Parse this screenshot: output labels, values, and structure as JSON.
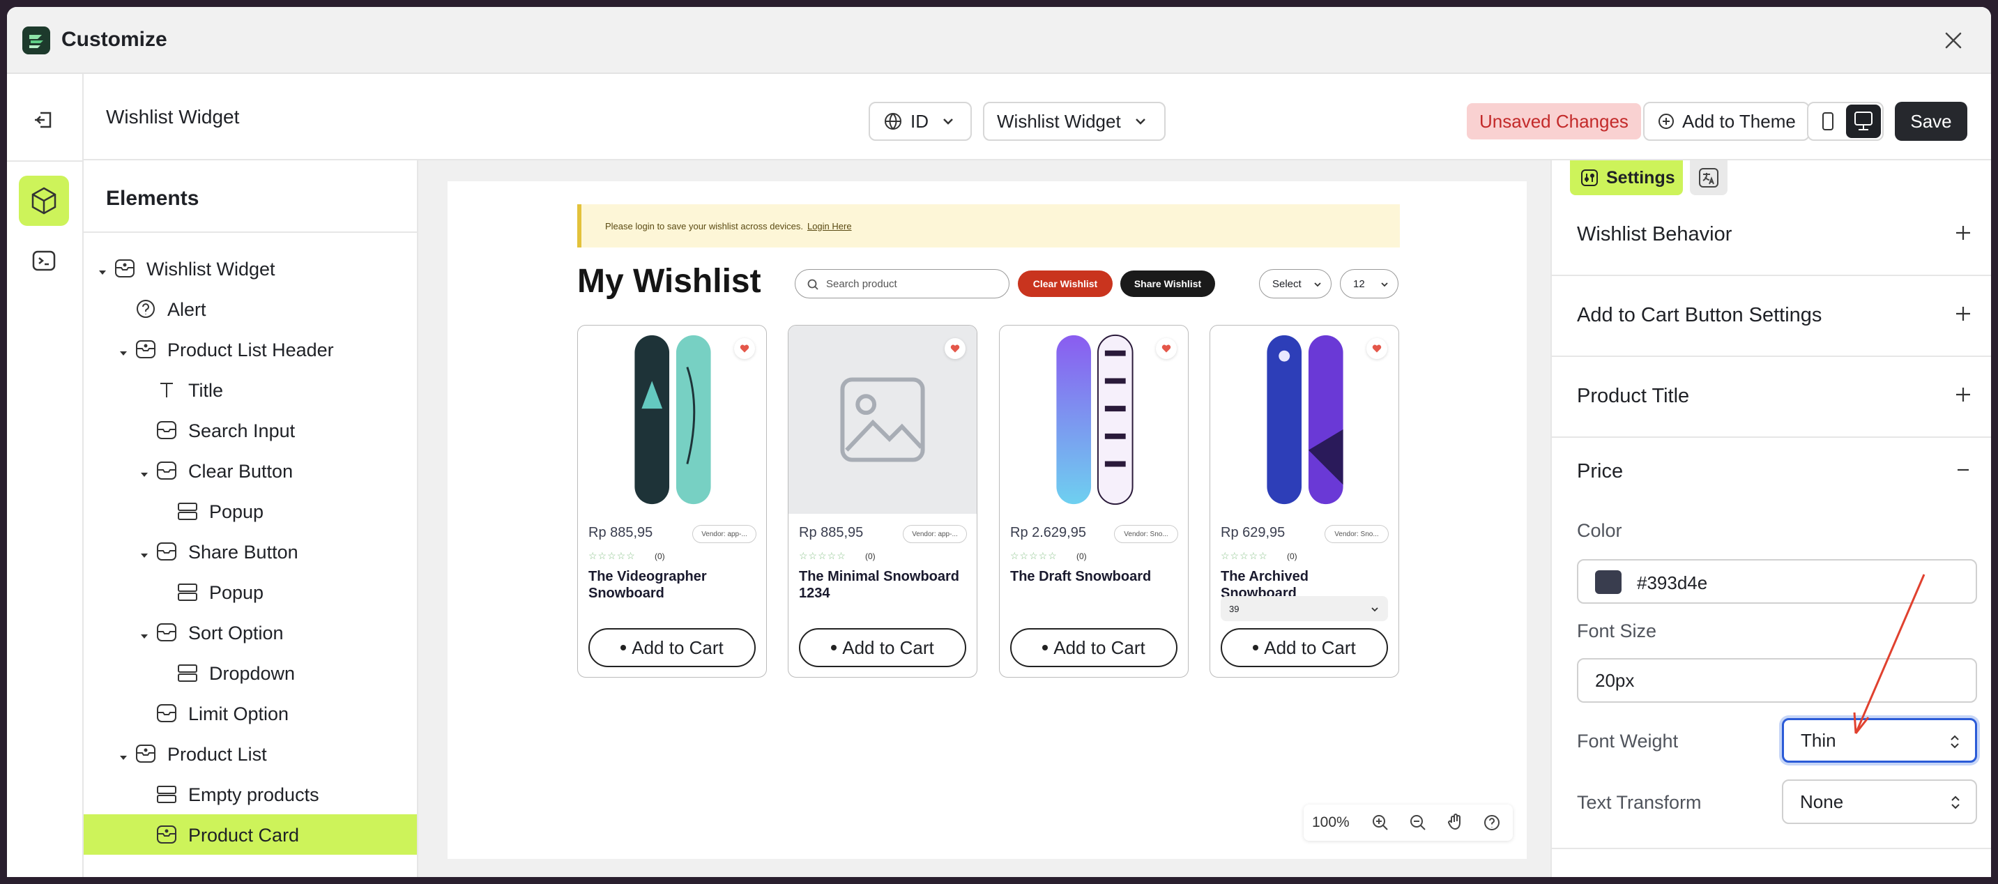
{
  "window": {
    "title": "Customize"
  },
  "topbar": {
    "page_name": "Wishlist Widget",
    "language": "ID",
    "template": "Wishlist Widget",
    "unsaved": "Unsaved Changes",
    "add_to_theme": "Add to Theme",
    "save": "Save"
  },
  "tree": {
    "title": "Elements",
    "items": [
      {
        "label": "Wishlist Widget",
        "icon": "widget-icon",
        "indent": 0,
        "caret": true
      },
      {
        "label": "Alert",
        "icon": "help-circle-icon",
        "indent": 1,
        "caret": false
      },
      {
        "label": "Product List Header",
        "icon": "widget-icon",
        "indent": 1,
        "caret": true
      },
      {
        "label": "Title",
        "icon": "text-icon",
        "indent": 2,
        "caret": false
      },
      {
        "label": "Search Input",
        "icon": "block-icon",
        "indent": 2,
        "caret": false
      },
      {
        "label": "Clear Button",
        "icon": "block-icon",
        "indent": 2,
        "caret": true
      },
      {
        "label": "Popup",
        "icon": "rows-icon",
        "indent": 3,
        "caret": false
      },
      {
        "label": "Share Button",
        "icon": "block-icon",
        "indent": 2,
        "caret": true
      },
      {
        "label": "Popup",
        "icon": "rows-icon",
        "indent": 3,
        "caret": false
      },
      {
        "label": "Sort Option",
        "icon": "block-icon",
        "indent": 2,
        "caret": true
      },
      {
        "label": "Dropdown",
        "icon": "rows-icon",
        "indent": 3,
        "caret": false
      },
      {
        "label": "Limit Option",
        "icon": "block-icon",
        "indent": 2,
        "caret": false
      },
      {
        "label": "Product List",
        "icon": "widget-icon",
        "indent": 1,
        "caret": true
      },
      {
        "label": "Empty products",
        "icon": "rows-icon",
        "indent": 2,
        "caret": false
      },
      {
        "label": "Product Card",
        "icon": "widget-icon",
        "indent": 2,
        "caret": false,
        "selected": true
      }
    ]
  },
  "preview": {
    "alert_text": "Please login to save your wishlist across devices.",
    "alert_link": "Login Here",
    "title": "My Wishlist",
    "search_placeholder": "Search product",
    "clear_label": "Clear Wishlist",
    "share_label": "Share Wishlist",
    "sort_label": "Select",
    "limit_label": "12",
    "stars": "☆☆☆☆☆",
    "add_to_cart": "Add to Cart",
    "products": [
      {
        "price": "Rp 885,95",
        "vendor": "Vendor: app-...",
        "reviews": "(0)",
        "title": "The Videographer Snowboard",
        "image": "snowboard-teal"
      },
      {
        "price": "Rp 885,95",
        "vendor": "Vendor: app-...",
        "reviews": "(0)",
        "title": "The Minimal Snowboard 1234",
        "image": "placeholder"
      },
      {
        "price": "Rp 2.629,95",
        "vendor": "Vendor: Sno...",
        "reviews": "(0)",
        "title": "The Draft Snowboard",
        "image": "snowboard-purple"
      },
      {
        "price": "Rp 629,95",
        "vendor": "Vendor: Sno...",
        "reviews": "(0)",
        "title": "The Archived Snowboard",
        "image": "snowboard-blue",
        "variant": "39"
      }
    ],
    "zoom": "100%"
  },
  "settings": {
    "tab": "Settings",
    "sections": [
      "Wishlist Behavior",
      "Add to Cart Button Settings",
      "Product Title"
    ],
    "open_section": "Price",
    "color_label": "Color",
    "color_value": "#393d4e",
    "font_size_label": "Font Size",
    "font_size_value": "20px",
    "font_weight_label": "Font Weight",
    "font_weight_value": "Thin",
    "text_transform_label": "Text Transform",
    "text_transform_value": "None"
  },
  "colors": {
    "accent": "#cdf35a",
    "danger": "#c9341e",
    "annotation": "#e0412f"
  }
}
